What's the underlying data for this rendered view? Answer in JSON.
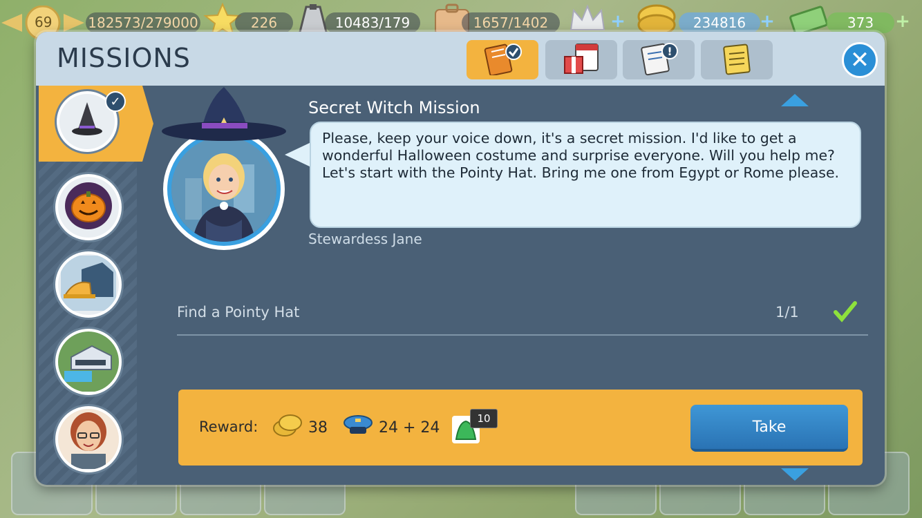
{
  "hud": {
    "level": "69",
    "xp": "182573/279000",
    "stars": "226",
    "fuel": "10483/179",
    "passengers": "1657/1402",
    "coins": "234816",
    "cash": "373"
  },
  "dialog": {
    "title": "MISSIONS",
    "close_label": "✕"
  },
  "mission": {
    "title": "Secret Witch Mission",
    "text": "Please, keep your voice down, it's a secret mission. I'd like to get a wonderful Halloween costume and surprise everyone. Will you help me? Let's start with the Pointy Hat. Bring me one from Egypt or Rome please.",
    "npc_name": "Stewardess Jane"
  },
  "objective": {
    "label": "Find a Pointy Hat",
    "progress": "1/1"
  },
  "reward": {
    "label": "Reward:",
    "coins": "38",
    "pilots": "24 + 24",
    "item_count": "10",
    "take_label": "Take"
  },
  "icons": {
    "tab1": "mission-notebook-icon",
    "tab2": "gift-calendar-icon",
    "tab3": "schedule-alert-icon",
    "tab4": "notepad-icon"
  },
  "colors": {
    "accent": "#f3b33f",
    "panel": "#4a6076",
    "header": "#c8d9e6",
    "button": "#2a73b4"
  }
}
